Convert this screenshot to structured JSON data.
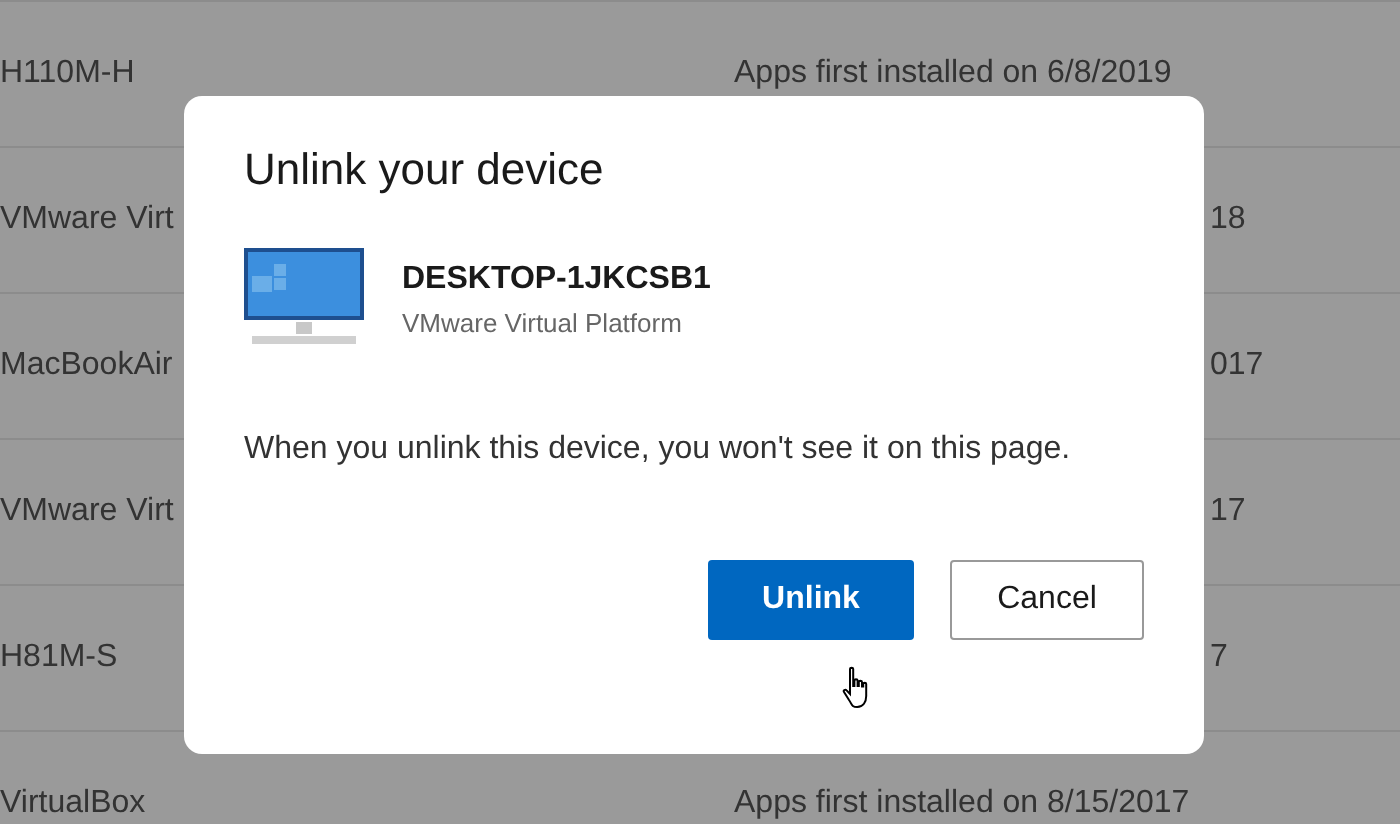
{
  "device_list": [
    {
      "kind": "full",
      "name": "H110M-H",
      "detail": "Apps first installed on 6/8/2019"
    },
    {
      "kind": "cut",
      "name": "VMware Virt",
      "detail": "18"
    },
    {
      "kind": "cut",
      "name": "MacBookAir",
      "detail": "017"
    },
    {
      "kind": "cut",
      "name": "VMware Virt",
      "detail": "17"
    },
    {
      "kind": "cut",
      "name": "H81M-S",
      "detail": "7"
    },
    {
      "kind": "full",
      "name": "VirtualBox",
      "detail": "Apps first installed on 8/15/2017"
    }
  ],
  "dialog": {
    "title": "Unlink your device",
    "device_name": "DESKTOP-1JKCSB1",
    "device_model": "VMware Virtual Platform",
    "message": "When you unlink this device, you won't see it on this page.",
    "buttons": [
      {
        "kind": "primary",
        "label": "Unlink"
      },
      {
        "kind": "secondary",
        "label": "Cancel"
      }
    ]
  }
}
